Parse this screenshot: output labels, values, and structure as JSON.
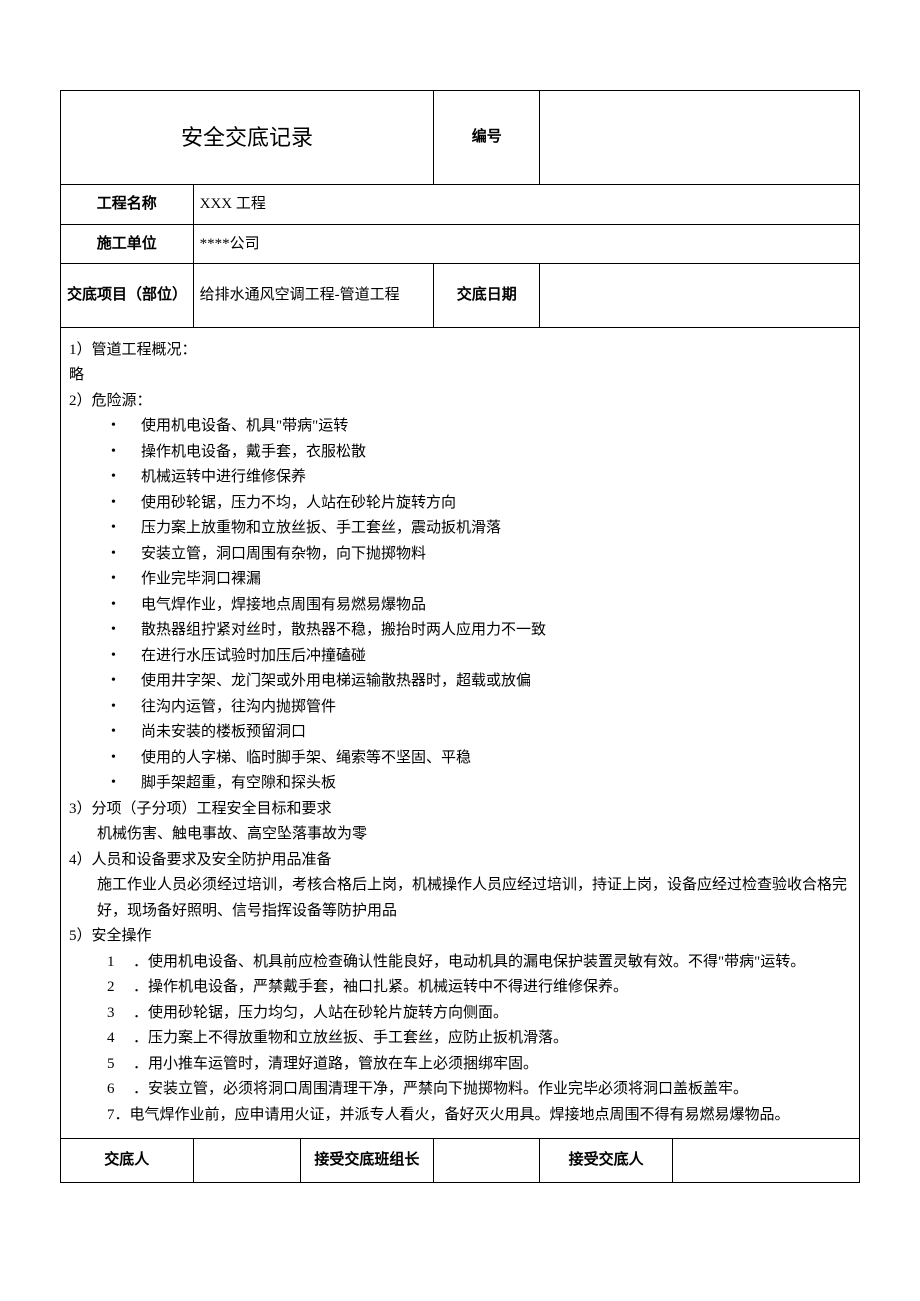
{
  "title": "安全交底记录",
  "header": {
    "number_label": "编号",
    "number_value": "",
    "project_name_label": "工程名称",
    "project_name_value": "XXX 工程",
    "construction_unit_label": "施工单位",
    "construction_unit_value": "****公司",
    "disclosure_item_label": "交底项目（部位）",
    "disclosure_item_value": "给排水通风空调工程-管道工程",
    "disclosure_date_label": "交底日期",
    "disclosure_date_value": ""
  },
  "content": {
    "s1_title": "1）管道工程概况：",
    "s1_body": "略",
    "s2_title": "2）危险源：",
    "hazards": [
      "使用机电设备、机具\"带病\"运转",
      "操作机电设备，戴手套，衣服松散",
      "机械运转中进行维修保养",
      "使用砂轮锯，压力不均，人站在砂轮片旋转方向",
      "压力案上放重物和立放丝扳、手工套丝，震动扳机滑落",
      "安装立管，洞口周围有杂物，向下抛掷物料",
      "作业完毕洞口裸漏",
      "电气焊作业，焊接地点周围有易燃易爆物品",
      "散热器组拧紧对丝时，散热器不稳，搬抬时两人应用力不一致",
      "在进行水压试验时加压后冲撞磕碰",
      "使用井字架、龙门架或外用电梯运输散热器时，超载或放偏",
      "往沟内运管，往沟内抛掷管件",
      "尚未安装的楼板预留洞口",
      "使用的人字梯、临时脚手架、绳索等不坚固、平稳",
      "脚手架超重，有空隙和探头板"
    ],
    "s3_title": "3）分项（子分项）工程安全目标和要求",
    "s3_body": "机械伤害、触电事故、高空坠落事故为零",
    "s4_title": "4）人员和设备要求及安全防护用品准备",
    "s4_body": "施工作业人员必须经过培训，考核合格后上岗，机械操作人员应经过培训，持证上岗，设备应经过检查验收合格完好，现场备好照明、信号指挥设备等防护用品",
    "s5_title": "5）安全操作",
    "ops": {
      "n1": "1",
      "t1": "．使用机电设备、机具前应检查确认性能良好，电动机具的漏电保护装置灵敏有效。不得\"带病\"运转。",
      "n2": "2",
      "t2": "．操作机电设备，严禁戴手套，袖口扎紧。机械运转中不得进行维修保养。",
      "n3": "3",
      "t3": "．使用砂轮锯，压力均匀，人站在砂轮片旋转方向侧面。",
      "n4": "4",
      "t4": "．压力案上不得放重物和立放丝扳、手工套丝，应防止扳机滑落。",
      "n5": "5",
      "t5": "．用小推车运管时，清理好道路，管放在车上必须捆绑牢固。",
      "n6": "6",
      "t6": "．安装立管，必须将洞口周围清理干净，严禁向下抛掷物料。作业完毕必须将洞口盖板盖牢。",
      "t7": "7．电气焊作业前，应申请用火证，并派专人看火，备好灭火用具。焊接地点周围不得有易燃易爆物品。"
    }
  },
  "footer": {
    "discloser_label": "交底人",
    "discloser_value": "",
    "leader_label": "接受交底班组长",
    "leader_value": "",
    "receiver_label": "接受交底人",
    "receiver_value": ""
  }
}
